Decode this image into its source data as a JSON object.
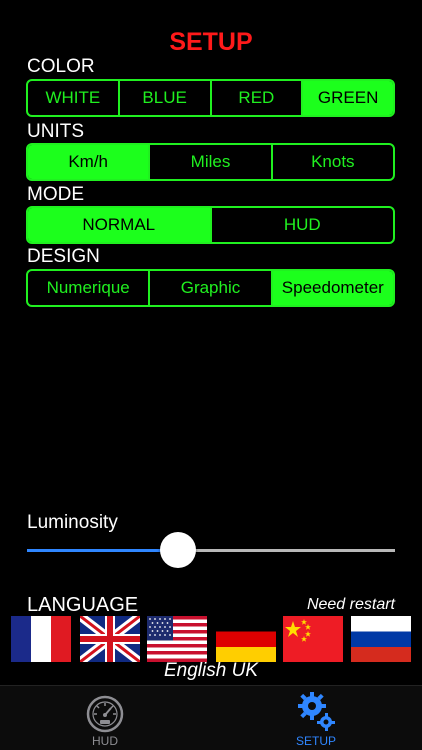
{
  "title": "SETUP",
  "color": {
    "label": "COLOR",
    "options": [
      "WHITE",
      "BLUE",
      "RED",
      "GREEN"
    ],
    "selected": "GREEN"
  },
  "units": {
    "label": "UNITS",
    "options": [
      "Km/h",
      "Miles",
      "Knots"
    ],
    "selected": "Km/h"
  },
  "mode": {
    "label": "MODE",
    "options": [
      "NORMAL",
      "HUD"
    ],
    "selected": "NORMAL"
  },
  "design": {
    "label": "DESIGN",
    "options": [
      "Numerique",
      "Graphic",
      "Speedometer"
    ],
    "selected": "Speedometer"
  },
  "luminosity": {
    "label": "Luminosity",
    "value_fraction": 0.41
  },
  "language": {
    "label": "LANGUAGE",
    "note": "Need restart",
    "flags": [
      "france-flag",
      "uk-flag",
      "usa-flag",
      "germany-flag",
      "china-flag",
      "russia-flag"
    ],
    "current": "English UK"
  },
  "tabbar": {
    "tabs": [
      {
        "label": "HUD",
        "icon": "speedometer-icon",
        "active": false
      },
      {
        "label": "SETUP",
        "icon": "gears-icon",
        "active": true
      }
    ]
  },
  "colors": {
    "accent_green": "#1cff1c",
    "title_red": "#ff1a1a",
    "slider_blue": "#2f86ff",
    "tab_active_blue": "#2f86ff",
    "tab_inactive_gray": "#8e8e93"
  }
}
